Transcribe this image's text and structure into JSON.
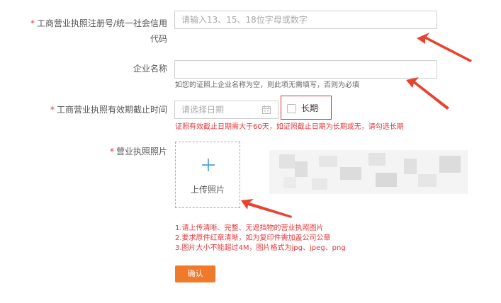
{
  "form": {
    "required_mark": "*",
    "license_no": {
      "label_line1": "工商营业执照注册号/统一社会信用",
      "label_line2": "代码",
      "placeholder": "请输入13、15、18位字母或数字"
    },
    "company_name": {
      "label": "企业名称",
      "hint": "如您的证照上企业名称为空，则此项无需填写，否则为必填"
    },
    "expiry": {
      "label": "工商营业执照有效期截止时间",
      "placeholder": "请选择日期",
      "long_term_label": "长期",
      "hint": "证照有效截止日期需大于60天，如证照截止日期为长期或无，请勾选长期"
    },
    "photo": {
      "label": "营业执照照片",
      "upload_label": "上传照片",
      "requirements": [
        "1.请上传清晰、完整、无遮挡物的营业执照图片",
        "2.要求原件红章清晰，如为复印件需加盖公司公章",
        "3.图片大小不能超过4M，图片格式为jpg、jpeg、png"
      ]
    },
    "confirm_label": "确认"
  },
  "colors": {
    "required": "#e4393c",
    "button": "#f07a2a",
    "annotation_arrow": "#e8432f",
    "highlight_box": "#d9332e",
    "upload_plus": "#2f8fd8"
  },
  "icons": [
    "calendar-icon",
    "plus-icon",
    "annotation-arrow"
  ]
}
